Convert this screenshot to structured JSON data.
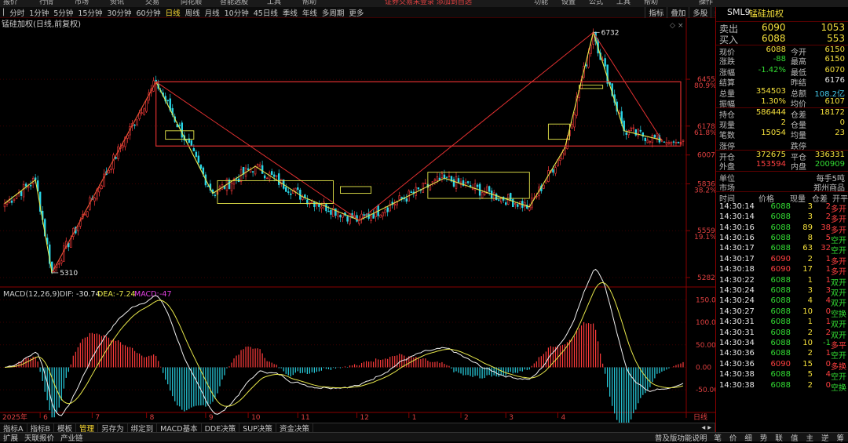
{
  "menu": {
    "items": [
      "报价",
      "行情",
      "市场",
      "资讯",
      "交易",
      "同花顺",
      "智能选股",
      "工具",
      "帮助"
    ],
    "warning": "证券交易未登录  添加到自选",
    "right_items": [
      "功能",
      "设置",
      "公式",
      "工具",
      "帮助",
      "操作"
    ]
  },
  "period_bar": {
    "items": [
      "分时",
      "1分钟",
      "5分钟",
      "15分钟",
      "30分钟",
      "60分钟",
      "日线",
      "周线",
      "月线",
      "10分钟",
      "45日线",
      "季线",
      "年线",
      "多周期",
      "更多"
    ],
    "active": "日线",
    "right_items": [
      "指标",
      "叠加",
      "多股",
      "统计",
      "画线",
      "F10",
      "标记",
      "+自选",
      "返回"
    ]
  },
  "chart_data": [
    {
      "type": "candlestick",
      "title": "锰硅加权(日线,前复权)",
      "ylim": [
        5240,
        6780
      ],
      "price_ticks": [
        6455,
        6178,
        6007,
        5836,
        5559,
        5282
      ],
      "pct_ticks": [
        {
          "value": 6455,
          "label": "80.9%"
        },
        {
          "value": 6178,
          "label": "61.8%"
        },
        {
          "value": 5836,
          "label": "38.2%"
        },
        {
          "value": 5559,
          "label": "19.1%"
        }
      ],
      "annotations": [
        {
          "text": "6732",
          "value": 6732
        },
        {
          "text": "5310",
          "value": 5310
        }
      ],
      "x_labels": [
        "2025年",
        "6",
        "7",
        "8",
        "9",
        "10",
        "11",
        "12",
        "1",
        "2",
        "3",
        "4"
      ],
      "period_label": "日线",
      "x_trade_days": 288,
      "key_points": [
        [
          0,
          5720
        ],
        [
          13,
          5860
        ],
        [
          20,
          5310
        ],
        [
          64,
          6440
        ],
        [
          88,
          5780
        ],
        [
          106,
          5940
        ],
        [
          126,
          5760
        ],
        [
          150,
          5620
        ],
        [
          186,
          5870
        ],
        [
          222,
          5700
        ],
        [
          237,
          6050
        ],
        [
          249,
          6732
        ],
        [
          262,
          6150
        ],
        [
          278,
          6095
        ]
      ]
    },
    {
      "type": "macd",
      "title": "MACD(12,26,9)",
      "dif": -30.74,
      "dea": -7.24,
      "macd": -47.0,
      "ylim": [
        -95,
        175
      ],
      "ticks": [
        150,
        100,
        50,
        0,
        -50
      ],
      "tick_labels": [
        "150.00",
        "100.00",
        "50.00",
        "0.00",
        "-50.00"
      ]
    }
  ],
  "quote": {
    "code": "SML9",
    "name": "锰硅加权",
    "sell": {
      "label": "卖出",
      "price": "6090",
      "volume": "1053"
    },
    "buy": {
      "label": "买入",
      "price": "6088",
      "volume": "553"
    },
    "stats": [
      [
        "现价",
        "6088",
        "今开",
        "6150"
      ],
      [
        "涨跌",
        "-88",
        "最高",
        "6150"
      ],
      [
        "涨幅",
        "-1.42%",
        "最低",
        "6070"
      ],
      [
        "结算",
        "",
        "昨结",
        "6176"
      ],
      [
        "总量",
        "354503",
        "总额",
        "108.2亿"
      ],
      [
        "振幅",
        "1.30%",
        "均价",
        "6107"
      ]
    ],
    "stats2": [
      [
        "持仓",
        "586444",
        "仓差",
        "18172"
      ],
      [
        "现量",
        "2",
        "仓量",
        "0"
      ],
      [
        "笔数",
        "15054",
        "均量",
        "23"
      ],
      [
        "涨停",
        "",
        "跌停",
        ""
      ]
    ],
    "stats3": [
      [
        "开仓",
        "372675",
        "平仓",
        "336331"
      ],
      [
        "外盘",
        "153594",
        "内盘",
        "200909"
      ]
    ],
    "info": [
      [
        "单位",
        "每手5吨"
      ],
      [
        "市场",
        "郑州商品"
      ]
    ]
  },
  "ticks_table": {
    "headers": [
      "时间",
      "价格",
      "现量",
      "仓差",
      "开平"
    ],
    "rows": [
      [
        "14:30:14",
        "6088",
        "3",
        "2",
        "多开"
      ],
      [
        "14:30:14",
        "6088",
        "3",
        "2",
        "多开"
      ],
      [
        "14:30:16",
        "6088",
        "89",
        "38",
        "多开"
      ],
      [
        "14:30:16",
        "6088",
        "8",
        "5",
        "空开"
      ],
      [
        "14:30:17",
        "6088",
        "63",
        "32",
        "空开"
      ],
      [
        "14:30:17",
        "6090",
        "2",
        "1",
        "多开"
      ],
      [
        "14:30:18",
        "6090",
        "17",
        "1",
        "多开"
      ],
      [
        "14:30:22",
        "6088",
        "1",
        "1",
        "双开"
      ],
      [
        "14:30:24",
        "6088",
        "3",
        "3",
        "双开"
      ],
      [
        "14:30:24",
        "6088",
        "4",
        "4",
        "双开"
      ],
      [
        "14:30:27",
        "6088",
        "10",
        "0",
        "空换"
      ],
      [
        "14:30:31",
        "6088",
        "1",
        "1",
        "双开"
      ],
      [
        "14:30:31",
        "6088",
        "2",
        "2",
        "双开"
      ],
      [
        "14:30:34",
        "6088",
        "10",
        "-1",
        "多平"
      ],
      [
        "14:30:36",
        "6088",
        "2",
        "1",
        "空开"
      ],
      [
        "14:30:36",
        "6090",
        "15",
        "0",
        "多换"
      ],
      [
        "14:30:38",
        "6088",
        "5",
        "4",
        "空开"
      ],
      [
        "14:30:38",
        "6088",
        "2",
        "0",
        "空换"
      ]
    ]
  },
  "bottom_tabs": {
    "items": [
      "指标A",
      "指标B",
      "模板",
      "管理",
      "另存为",
      "绑定到",
      "MACD基本",
      "DDE决策",
      "SUP决策",
      "资金决策"
    ],
    "active": "管理"
  },
  "status_bar": {
    "left": [
      "扩展",
      "天联报价",
      "产业链"
    ],
    "right": "普及版功能说明",
    "right_tabs": [
      "笔",
      "价",
      "细",
      "势",
      "联",
      "值",
      "主",
      "逆",
      "筹"
    ]
  }
}
